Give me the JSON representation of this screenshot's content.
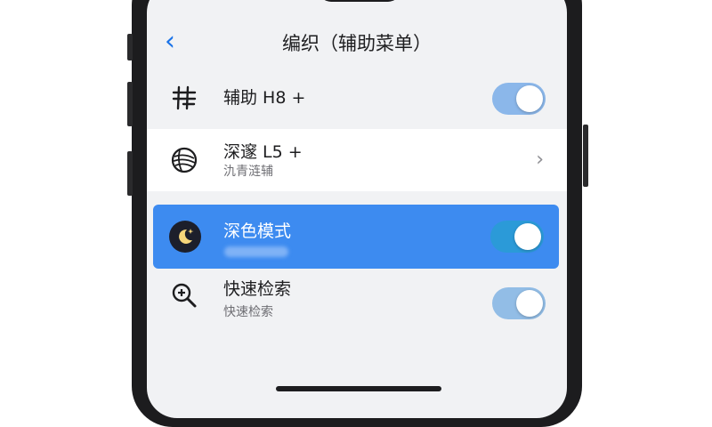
{
  "nav": {
    "back": "‹",
    "title": "编织（辅助菜单）"
  },
  "rows": [
    {
      "label": "辅助 H8 +",
      "icon": "hash-icon",
      "toggle_on": true
    },
    {
      "label": "深邃 L5 +",
      "subtitle": "氿青涟辅",
      "icon": "yarn-ball-icon",
      "chevron": "›"
    },
    {
      "label": "深色模式",
      "icon": "moon-icon",
      "toggle_on": true,
      "selected": true
    },
    {
      "label": "快速检索",
      "subtitle": "快速检索",
      "icon": "zoom-in-icon",
      "toggle_on": true
    }
  ],
  "colors": {
    "accent": "#3d8bf0",
    "toggle": "#8bb7ea",
    "back": "#1a73e8"
  }
}
